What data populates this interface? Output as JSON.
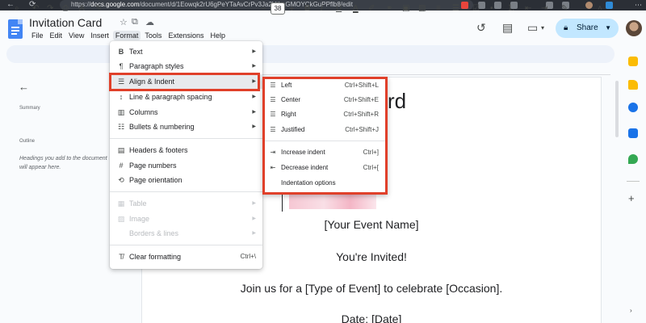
{
  "browser": {
    "url_host": "docs.google.com",
    "url_path": "/document/d/1Eowqk2rU6gPeYTaAvCrPv3Ja2VthaGMOYCkGuPPflb8/edit",
    "url_scheme": "https://"
  },
  "doc": {
    "title": "Invitation Card"
  },
  "menubar": {
    "items": [
      "File",
      "Edit",
      "View",
      "Insert",
      "Format",
      "Tools",
      "Extensions",
      "Help"
    ]
  },
  "header": {
    "share_label": "Share"
  },
  "toolbar": {
    "font_size": "38"
  },
  "left_panel": {
    "summary_heading": "Summary",
    "outline_heading": "Outline",
    "outline_hint": "Headings you add to the document will appear here."
  },
  "document": {
    "partial_title": "rd",
    "event_name": "[Your Event Name]",
    "invited": "You're Invited!",
    "join_line": "Join us for a [Type of Event] to celebrate [Occasion].",
    "date_line": "Date: [Date]"
  },
  "format_menu": {
    "items": [
      {
        "label": "Text",
        "icon": "bold-icon",
        "submenu": true
      },
      {
        "label": "Paragraph styles",
        "icon": "paragraph-icon",
        "submenu": true
      },
      {
        "label": "Align & Indent",
        "icon": "align-indent-icon",
        "submenu": true
      },
      {
        "label": "Line & paragraph spacing",
        "icon": "line-spacing-icon",
        "submenu": true
      },
      {
        "label": "Columns",
        "icon": "columns-icon",
        "submenu": true
      },
      {
        "label": "Bullets & numbering",
        "icon": "bullets-icon",
        "submenu": true
      },
      {
        "label": "Headers & footers",
        "icon": "header-footer-icon",
        "submenu": false
      },
      {
        "label": "Page numbers",
        "icon": "hash-icon",
        "submenu": false
      },
      {
        "label": "Page orientation",
        "icon": "orientation-icon",
        "submenu": false
      },
      {
        "label": "Table",
        "icon": "table-icon",
        "submenu": true
      },
      {
        "label": "Image",
        "icon": "image-icon",
        "submenu": true
      },
      {
        "label": "Borders & lines",
        "icon": "borders-icon",
        "submenu": true
      },
      {
        "label": "Clear formatting",
        "icon": "clear-format-icon",
        "shortcut": "Ctrl+\\"
      }
    ]
  },
  "align_submenu": {
    "items": [
      {
        "label": "Left",
        "shortcut": "Ctrl+Shift+L",
        "icon": "align-left-icon"
      },
      {
        "label": "Center",
        "shortcut": "Ctrl+Shift+E",
        "icon": "align-center-icon"
      },
      {
        "label": "Right",
        "shortcut": "Ctrl+Shift+R",
        "icon": "align-right-icon"
      },
      {
        "label": "Justified",
        "shortcut": "Ctrl+Shift+J",
        "icon": "align-justify-icon"
      },
      {
        "label": "Increase indent",
        "shortcut": "Ctrl+]",
        "icon": "indent-increase-icon"
      },
      {
        "label": "Decrease indent",
        "shortcut": "Ctrl+[",
        "icon": "indent-decrease-icon"
      },
      {
        "label": "Indentation options",
        "shortcut": "",
        "icon": ""
      }
    ]
  },
  "colors": {
    "highlight_outline": "#e0402a",
    "share_bg": "#c2e7ff",
    "docs_blue": "#4285f4"
  }
}
